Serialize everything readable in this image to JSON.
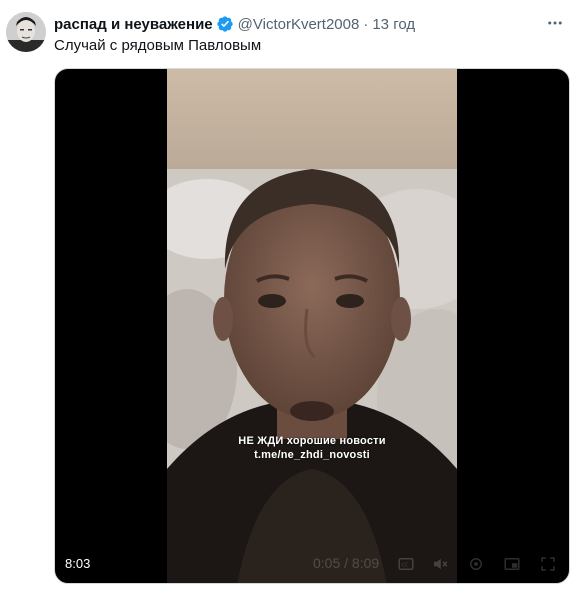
{
  "tweet": {
    "display_name": "распад и неуважение",
    "handle": "@VictorKvert2008",
    "separator": "·",
    "time": "13 год",
    "text": "Случай с рядовым Павловым"
  },
  "icons": {
    "avatar": "avatar-image",
    "verified": "verified-badge-icon",
    "more": "more-options-icon",
    "captions": "captions-icon",
    "mute": "mute-icon",
    "settings": "gear-icon",
    "pip": "picture-in-picture-icon",
    "fullscreen": "fullscreen-icon"
  },
  "video": {
    "watermark_line1": "НЕ ЖДИ хорошие новости",
    "watermark_line2": "t.me/ne_zhdi_novosti",
    "duration": "8:03",
    "progress_text": "0:05 / 8:09"
  },
  "colors": {
    "verified_blue": "#1d9bf0",
    "secondary_text": "#536471",
    "primary_text": "#0f1419"
  }
}
